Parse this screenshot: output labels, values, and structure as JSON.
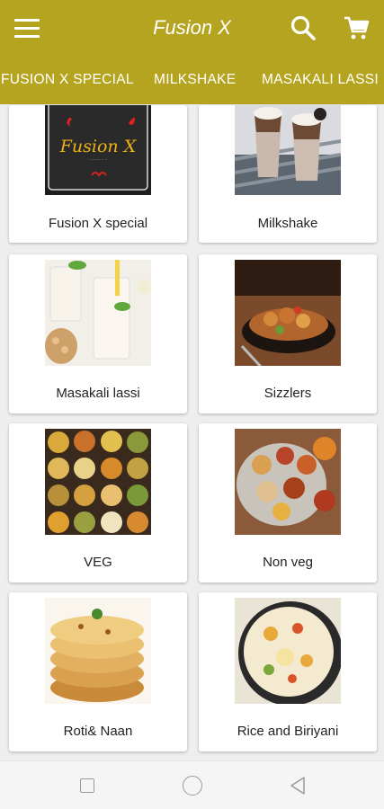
{
  "app": {
    "title": "Fusion X",
    "bar_color": "#b5a41f",
    "icons": [
      "menu-icon",
      "search-icon",
      "cart-icon"
    ]
  },
  "tabs": [
    {
      "label": "FUSION X SPECIAL"
    },
    {
      "label": "MILKSHAKE"
    },
    {
      "label": "MASAKALI LASSI"
    }
  ],
  "categories": [
    {
      "label": "Fusion X special",
      "logo_text": "Fusion X"
    },
    {
      "label": "Milkshake"
    },
    {
      "label": "Masakali lassi"
    },
    {
      "label": "Sizzlers"
    },
    {
      "label": "VEG"
    },
    {
      "label": "Non veg"
    },
    {
      "label": "Roti& Naan"
    },
    {
      "label": "Rice and Biriyani"
    }
  ],
  "system_nav": {
    "icons": [
      "recents-square-icon",
      "home-circle-icon",
      "back-triangle-icon"
    ]
  }
}
